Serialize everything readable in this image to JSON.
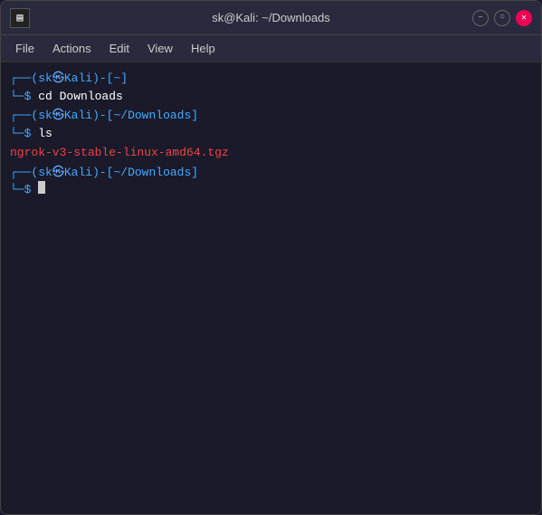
{
  "window": {
    "title": "sk@Kali: ~/Downloads",
    "controls": {
      "minimize": "–",
      "maximize": "○",
      "close": "✕"
    }
  },
  "menubar": {
    "items": [
      "File",
      "Actions",
      "Edit",
      "View",
      "Help"
    ]
  },
  "terminal": {
    "lines": [
      {
        "type": "prompt",
        "user": "sk",
        "host": "Kali",
        "path": "~",
        "command": "cd Downloads"
      },
      {
        "type": "prompt",
        "user": "sk",
        "host": "Kali",
        "path": "~/Downloads",
        "command": "ls"
      },
      {
        "type": "output",
        "text": "ngrok-v3-stable-linux-amd64.tgz"
      },
      {
        "type": "prompt_empty",
        "user": "sk",
        "host": "Kali",
        "path": "~/Downloads",
        "command": ""
      }
    ]
  }
}
